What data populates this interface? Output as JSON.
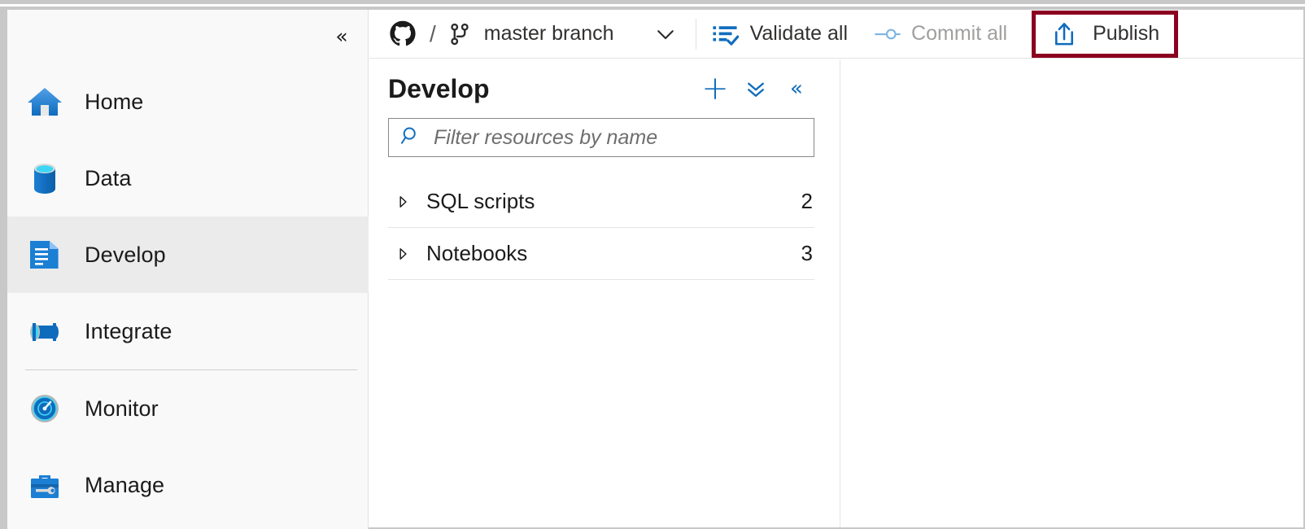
{
  "window": {
    "accent_blue": "#0f6cbd",
    "highlight_red": "#8b0020",
    "selected_row_bg": "#ebebeb",
    "sidebar_bg": "#f9f9f9"
  },
  "sidebar": {
    "collapse_icon": "chevron-double-left-icon",
    "collapse_glyph": "«",
    "items": [
      {
        "label": "Home",
        "icon": "home-icon",
        "selected": false,
        "divider_after": false
      },
      {
        "label": "Data",
        "icon": "database-icon",
        "selected": false,
        "divider_after": false
      },
      {
        "label": "Develop",
        "icon": "document-icon",
        "selected": true,
        "divider_after": false
      },
      {
        "label": "Integrate",
        "icon": "pipeline-icon",
        "selected": false,
        "divider_after": true
      },
      {
        "label": "Monitor",
        "icon": "gauge-icon",
        "selected": false,
        "divider_after": false
      },
      {
        "label": "Manage",
        "icon": "toolbox-icon",
        "selected": false,
        "divider_after": false
      }
    ]
  },
  "toolbar": {
    "repo_icon": "github-icon",
    "separator": "/",
    "branch_icon": "git-branch-icon",
    "branch_label": "master branch",
    "branch_dropdown_icon": "chevron-down-icon",
    "branch_dropdown_glyph": "⌄",
    "validate": {
      "label": "Validate all",
      "icon": "validate-list-check-icon",
      "enabled": true
    },
    "commit": {
      "label": "Commit all",
      "icon": "commit-node-icon",
      "enabled": false
    },
    "publish": {
      "label": "Publish",
      "icon": "publish-upload-icon",
      "enabled": true,
      "highlighted": true
    }
  },
  "panel": {
    "title": "Develop",
    "actions": [
      {
        "name": "add-new-resource-button",
        "icon": "plus-icon",
        "glyph": "+"
      },
      {
        "name": "collapse-all-button",
        "icon": "chevron-double-down-icon",
        "glyph": "ˇ"
      },
      {
        "name": "hide-panel-button",
        "icon": "chevron-double-left-icon",
        "glyph": "«"
      }
    ],
    "search": {
      "icon": "search-icon",
      "placeholder": "Filter resources by name",
      "value": ""
    },
    "tree": [
      {
        "label": "SQL scripts",
        "count": "2",
        "expanded": false,
        "caret_icon": "caret-right-icon"
      },
      {
        "label": "Notebooks",
        "count": "3",
        "expanded": false,
        "caret_icon": "caret-right-icon"
      }
    ]
  }
}
